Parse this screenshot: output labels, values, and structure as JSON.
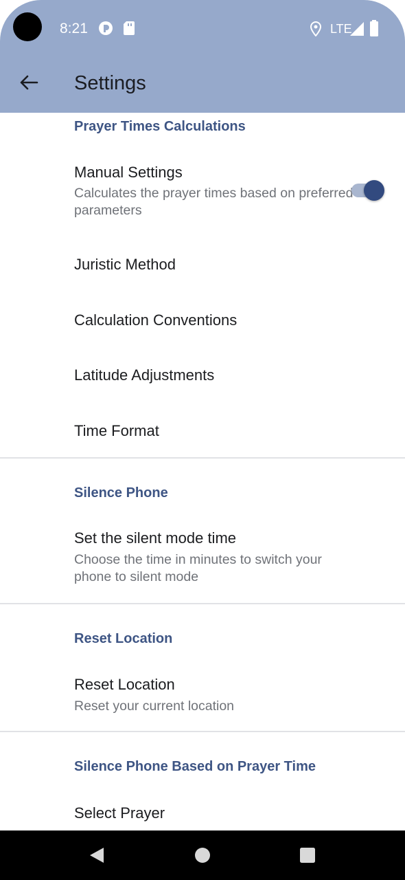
{
  "status_bar": {
    "time": "8:21",
    "network": "LTE",
    "icons": [
      "circle-app-icon",
      "sd-card-icon",
      "location-icon",
      "signal-icon",
      "battery-icon"
    ]
  },
  "app_bar": {
    "back_icon": "arrow-back-icon",
    "title": "Settings"
  },
  "sections": {
    "prayer_times": {
      "title": "Prayer Times Calculations",
      "manual": {
        "title": "Manual Settings",
        "subtitle": "Calculates the prayer times based on preferred parameters",
        "enabled": true
      },
      "juristic": "Juristic Method",
      "conventions": "Calculation Conventions",
      "latitude": "Latitude Adjustments",
      "time_format": "Time Format"
    },
    "silence_phone": {
      "title": "Silence Phone",
      "item_title": "Set the silent mode time",
      "item_subtitle": "Choose the time in minutes to switch your phone to silent mode"
    },
    "reset_location": {
      "title": "Reset Location",
      "item_title": "Reset Location",
      "item_subtitle": "Reset your current location"
    },
    "silence_by_prayer": {
      "title": "Silence Phone Based on Prayer Time",
      "item_title": "Select Prayer"
    }
  },
  "nav_bar": {
    "icons": [
      "back-triangle-icon",
      "home-circle-icon",
      "recents-square-icon"
    ]
  },
  "colors": {
    "top_bar": "#96a9cb",
    "accent": "#3e5584",
    "toggle_thumb": "#324a7f"
  }
}
